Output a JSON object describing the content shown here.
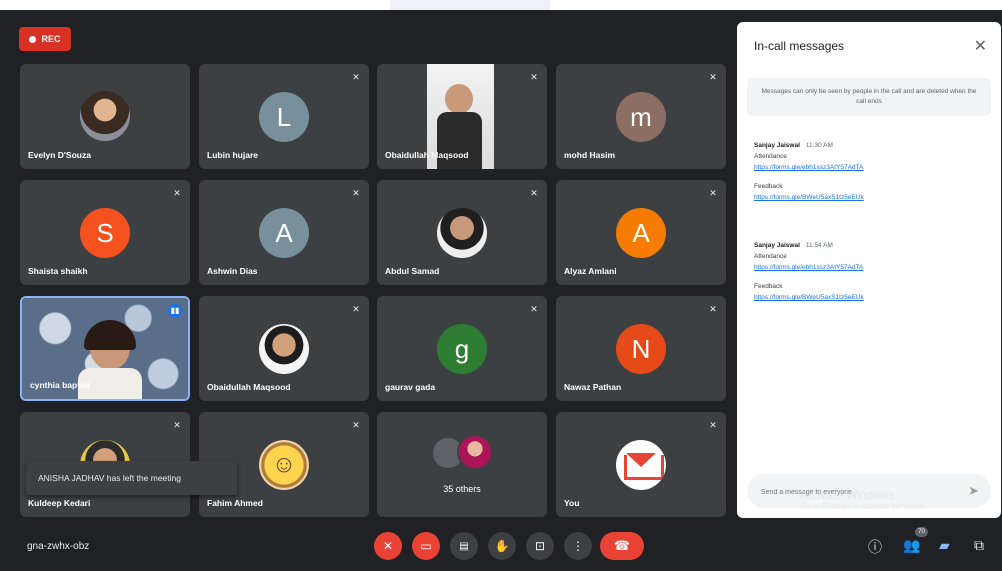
{
  "recording": {
    "label": "REC"
  },
  "participants": [
    {
      "name": "Evelyn D'Souza",
      "avatar_type": "photo"
    },
    {
      "name": "Lubin hujare",
      "avatar_type": "letter",
      "letter": "L",
      "color": "#78909c"
    },
    {
      "name": "Obaidullah Maqsood",
      "avatar_type": "video"
    },
    {
      "name": "mohd Hasim",
      "avatar_type": "letter",
      "letter": "m",
      "color": "#8d6e63"
    },
    {
      "name": "Shaista shaikh",
      "avatar_type": "letter",
      "letter": "S",
      "color": "#f4511e"
    },
    {
      "name": "Ashwin Dias",
      "avatar_type": "letter",
      "letter": "A",
      "color": "#78909c"
    },
    {
      "name": "Abdul Samad",
      "avatar_type": "photo"
    },
    {
      "name": "Alyaz Amlani",
      "avatar_type": "letter",
      "letter": "A",
      "color": "#f57c00"
    },
    {
      "name": "cynthia baptist",
      "avatar_type": "video"
    },
    {
      "name": "Obaidullah Maqsood",
      "avatar_type": "photo"
    },
    {
      "name": "gaurav gada",
      "avatar_type": "letter",
      "letter": "g",
      "color": "#2e7d32"
    },
    {
      "name": "Nawaz Pathan",
      "avatar_type": "letter",
      "letter": "N",
      "color": "#e64a19"
    },
    {
      "name": "Kuldeep Kedari",
      "avatar_type": "photo"
    },
    {
      "name": "Fahim Ahmed",
      "avatar_type": "emoji"
    },
    {
      "name": "35 others",
      "avatar_type": "group"
    },
    {
      "name": "You",
      "avatar_type": "gmail"
    }
  ],
  "toast": {
    "text": "ANISHA JADHAV has left the meeting"
  },
  "chat": {
    "title": "In-call messages",
    "notice": "Messages can only be seen by people in the call and are deleted when the call ends",
    "messages": [
      {
        "sender": "Sanjay Jaiswal",
        "time": "11:30 AM",
        "label1": "Attendance",
        "link1": "https://forms.gle/ebh1ssz3AtY57AdTA",
        "label2": "Feedback",
        "link2": "https://forms.gle/BWeU5axS1tz5eEUk"
      },
      {
        "sender": "Sanjay Jaiswal",
        "time": "11:54 AM",
        "label1": "Attendance",
        "link1": "https://forms.gle/ebh1ssz3AtY57AdTA",
        "label2": "Feedback",
        "link2": "https://forms.gle/BWeU5axS1tz5eEUk"
      }
    ],
    "input_placeholder": "Send a message to everyone"
  },
  "watermark": {
    "line1": "Activate Windows",
    "line2": "Go to Settings to activate Windows."
  },
  "footer": {
    "meeting_code": "gna-zwhx-obz",
    "participant_count": "70",
    "icons": {
      "mic": "mic-off-icon",
      "cam": "cam-off-icon",
      "captions": "captions-icon",
      "hand": "raise-hand-icon",
      "present": "present-icon",
      "more": "more-icon",
      "hangup": "phone-hangup-icon",
      "info": "info-icon",
      "people": "people-icon",
      "chat": "chat-icon",
      "activities": "activities-icon"
    }
  }
}
